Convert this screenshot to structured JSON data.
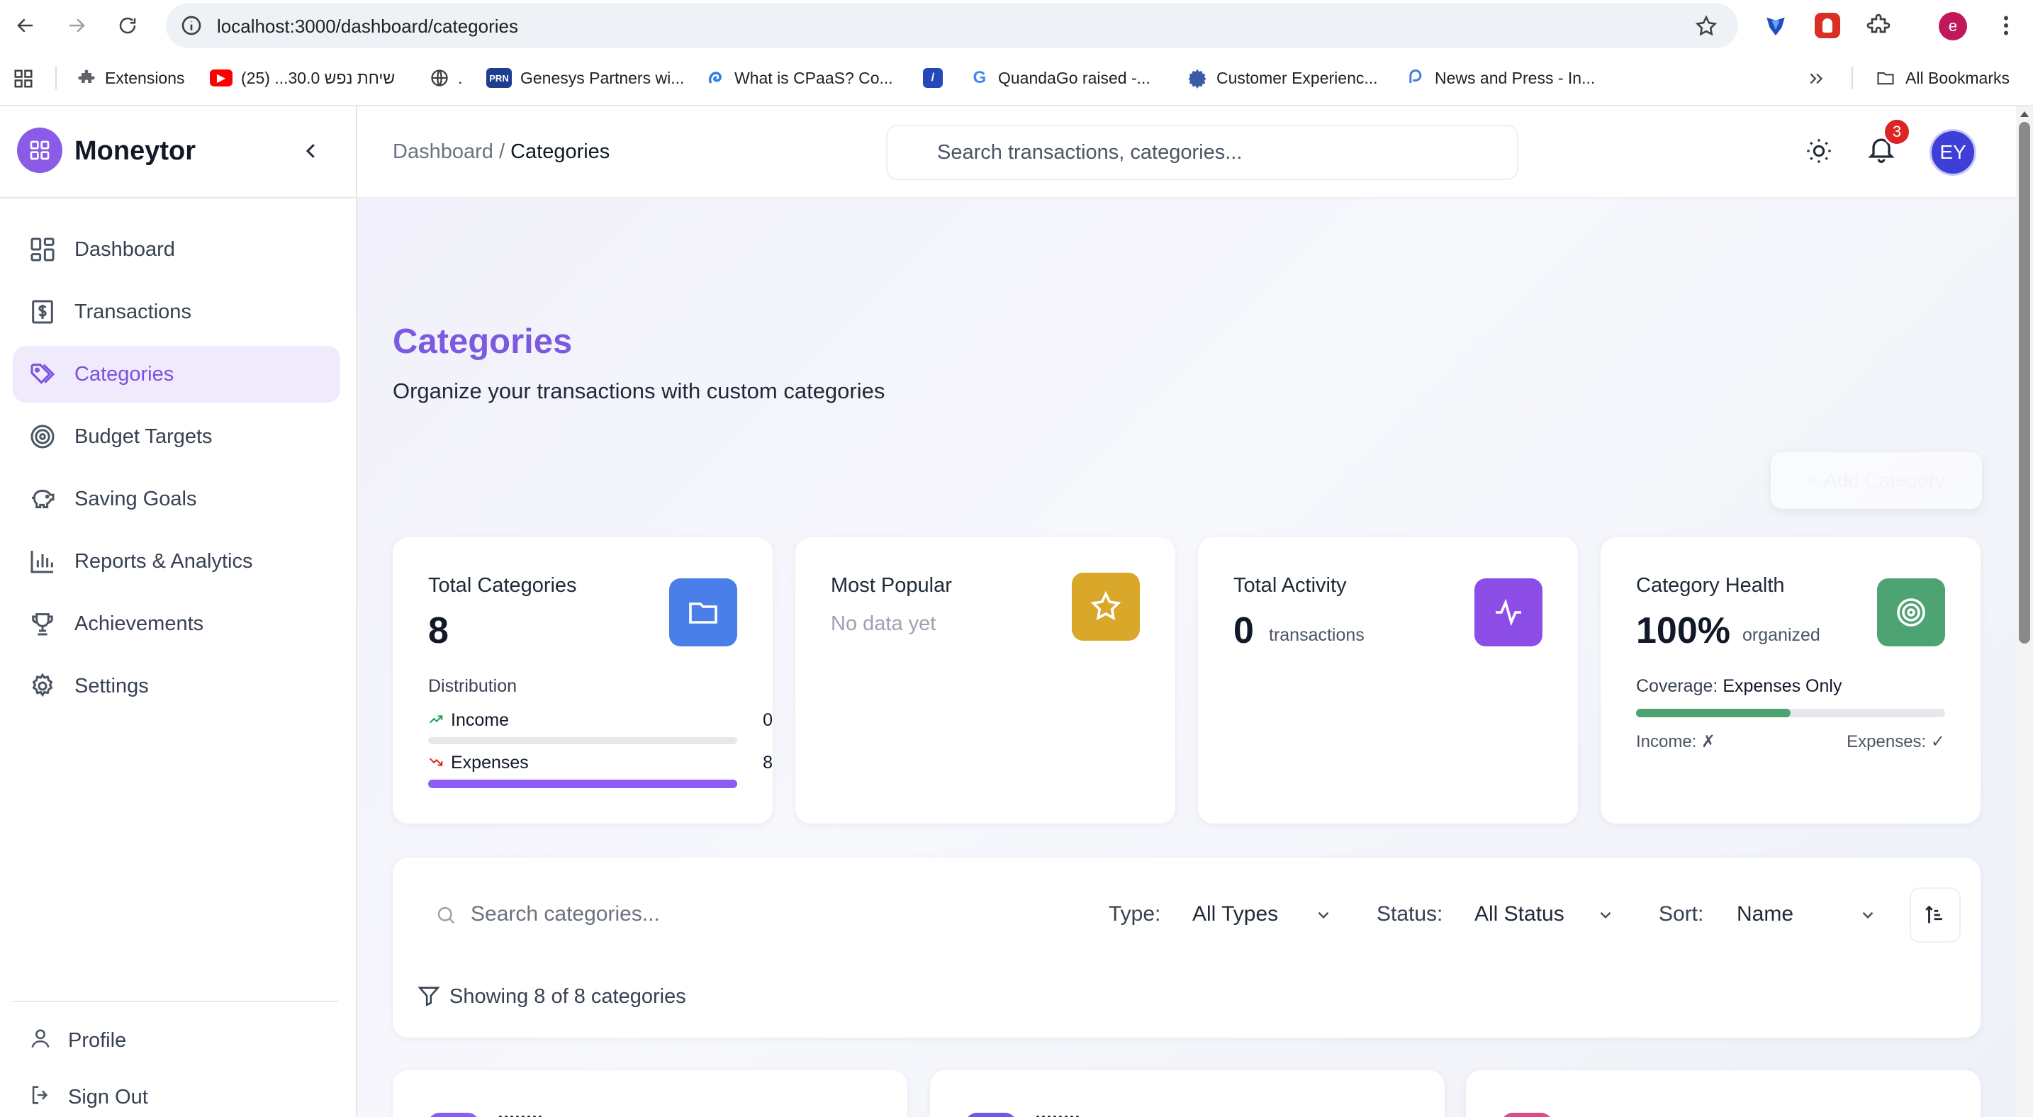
{
  "browser": {
    "url": "localhost:3000/dashboard/categories",
    "bookmarks": [
      {
        "label": "Extensions",
        "icon": "puzzle-icon"
      },
      {
        "label": "שיחת נפש 30.0... (25)",
        "icon": "youtube-icon"
      },
      {
        "label": ".",
        "icon": "globe-icon"
      },
      {
        "label": "Genesys Partners wi...",
        "icon": "prn-icon"
      },
      {
        "label": "What is CPaaS? Co...",
        "icon": "swirl-icon"
      },
      {
        "label": "",
        "icon": "blue-square-icon"
      },
      {
        "label": "QuandaGo raised -...",
        "icon": "google-icon"
      },
      {
        "label": "Customer Experienc...",
        "icon": "gear-puzzle-icon"
      },
      {
        "label": "News and Press - In...",
        "icon": "chat-icon"
      }
    ],
    "all_bookmarks": "All Bookmarks",
    "profile_initial": "e"
  },
  "app": {
    "name": "Moneytor",
    "nav": [
      {
        "label": "Dashboard",
        "icon": "dashboard-icon"
      },
      {
        "label": "Transactions",
        "icon": "receipt-icon"
      },
      {
        "label": "Categories",
        "icon": "tags-icon",
        "active": true
      },
      {
        "label": "Budget Targets",
        "icon": "target-icon"
      },
      {
        "label": "Saving Goals",
        "icon": "piggy-bank-icon"
      },
      {
        "label": "Reports & Analytics",
        "icon": "bar-chart-icon"
      },
      {
        "label": "Achievements",
        "icon": "trophy-icon"
      },
      {
        "label": "Settings",
        "icon": "gear-icon"
      }
    ],
    "footer": {
      "profile": "Profile",
      "sign_out": "Sign Out"
    }
  },
  "header": {
    "breadcrumb_parent": "Dashboard",
    "breadcrumb_sep": "/",
    "breadcrumb_current": "Categories",
    "search_placeholder": "Search transactions, categories...",
    "notification_count": "3",
    "avatar_initials": "EY"
  },
  "page": {
    "title": "Categories",
    "subtitle": "Organize your transactions with custom categories",
    "add_button": "+ Add Category"
  },
  "stats": {
    "total_categories": {
      "title": "Total Categories",
      "value": "8",
      "distribution_label": "Distribution",
      "income_label": "Income",
      "income_value": "0",
      "income_fraction": 0,
      "expenses_label": "Expenses",
      "expenses_value": "8",
      "expenses_fraction": 1
    },
    "most_popular": {
      "title": "Most Popular",
      "value": "No data yet"
    },
    "total_activity": {
      "title": "Total Activity",
      "value": "0",
      "unit": "transactions"
    },
    "category_health": {
      "title": "Category Health",
      "value": "100%",
      "unit": "organized",
      "coverage_label": "Coverage:",
      "coverage_value": "Expenses Only",
      "coverage_fraction": 0.5,
      "income_status": "Income: ✗",
      "expenses_status": "Expenses: ✓"
    }
  },
  "filters": {
    "search_placeholder": "Search categories...",
    "type_label": "Type:",
    "type_value": "All Types",
    "status_label": "Status:",
    "status_value": "All Status",
    "sort_label": "Sort:",
    "sort_value": "Name",
    "showing": "Showing 8 of 8 categories"
  },
  "colors": {
    "accent": "#7c4fe0",
    "blue": "#4a7ee8",
    "gold": "#d9a82a",
    "purple": "#8b4de6",
    "green": "#4ea373"
  }
}
